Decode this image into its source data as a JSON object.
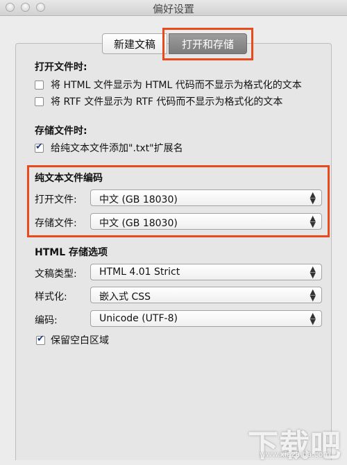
{
  "window": {
    "title": "偏好设置"
  },
  "tabs": [
    {
      "label": "新建文稿",
      "selected": false
    },
    {
      "label": "打开和存储",
      "selected": true
    }
  ],
  "open_section": {
    "heading": "打开文件时:",
    "options": [
      {
        "label": "将 HTML 文件显示为 HTML 代码而不显示为格式化的文本",
        "checked": false
      },
      {
        "label": "将 RTF 文件显示为 RTF 代码而不显示为格式化的文本",
        "checked": false
      }
    ]
  },
  "save_section": {
    "heading": "存储文件时:",
    "options": [
      {
        "label": "给纯文本文件添加\".txt\"扩展名",
        "checked": true
      }
    ]
  },
  "encoding_section": {
    "heading": "纯文本文件编码",
    "open_label": "打开文件:",
    "open_value": "中文 (GB 18030)",
    "save_label": "存储文件:",
    "save_value": "中文 (GB 18030)"
  },
  "html_section": {
    "heading": "HTML 存储选项",
    "doctype_label": "文稿类型:",
    "doctype_value": "HTML 4.01 Strict",
    "style_label": "样式化:",
    "style_value": "嵌入式 CSS",
    "encoding_label": "编码:",
    "encoding_value": "Unicode (UTF-8)",
    "whitespace_label": "保留空白区域",
    "whitespace_checked": true
  },
  "watermark": {
    "text": "下载吧",
    "url": "www.xiazaiba.com"
  },
  "colors": {
    "highlight": "#e8491d",
    "selected_tab": "#8a8a8a",
    "checkmark": "#1d3a8a"
  }
}
